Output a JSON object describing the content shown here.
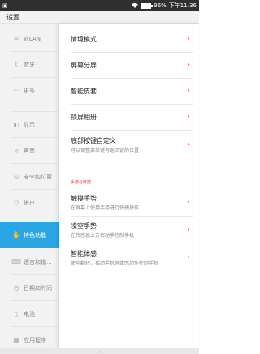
{
  "status": {
    "notif": "▣",
    "wifi_icon": "wifi-icon",
    "battery_percent": "96%",
    "battery_level": 0.96,
    "time": "下午11:36"
  },
  "title": "设置",
  "sidebar": {
    "items": [
      {
        "label": "WLAN",
        "icon": "≈"
      },
      {
        "label": "蓝牙",
        "icon": "ᛒ"
      },
      {
        "label": "更多",
        "icon": "···"
      },
      {
        "label": "显示",
        "icon": "◐"
      },
      {
        "label": "声音",
        "icon": "◃"
      },
      {
        "label": "安全和位置",
        "icon": "⊙"
      },
      {
        "label": "帐户",
        "icon": "⚇"
      },
      {
        "label": "特色功能",
        "icon": "✋"
      },
      {
        "label": "语言和输...",
        "icon": "⌨"
      },
      {
        "label": "日期和时间",
        "icon": "◷"
      },
      {
        "label": "电池",
        "icon": "▯"
      },
      {
        "label": "应用程序",
        "icon": "▦"
      }
    ]
  },
  "panel": {
    "items": [
      {
        "title": "情境模式",
        "sub": ""
      },
      {
        "title": "屏幕分屏",
        "sub": ""
      },
      {
        "title": "智能皮套",
        "sub": ""
      },
      {
        "title": "锁屏相册",
        "sub": ""
      },
      {
        "title": "底部按键自定义",
        "sub": "可以调整菜单键与返回键的位置"
      }
    ],
    "section_label": "手势与体感",
    "gesture_items": [
      {
        "title": "触摸手势",
        "sub": "在屏幕上使用手势进行快捷操作"
      },
      {
        "title": "凌空手势",
        "sub": "在传感器上方挥动手控制手机"
      },
      {
        "title": "智能体感",
        "sub": "使用翻转、摇动手机等体感动作控制手机"
      }
    ]
  },
  "chevron": "›",
  "bottom_caret": "︿"
}
